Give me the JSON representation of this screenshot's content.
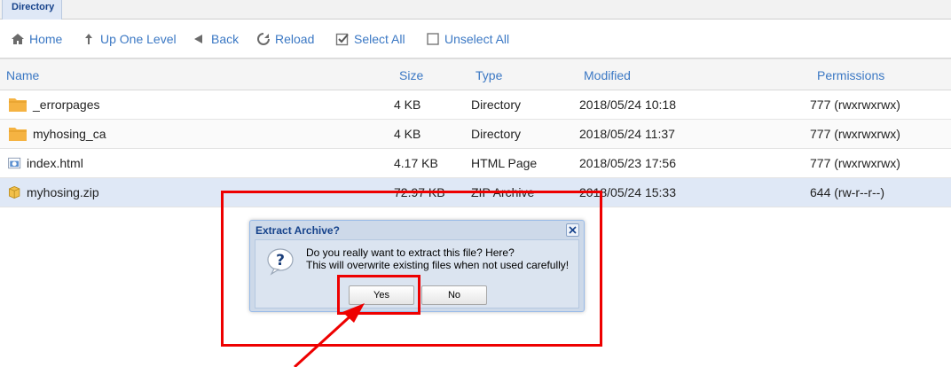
{
  "tab": {
    "label": "Directory"
  },
  "toolbar": {
    "home": "Home",
    "up_one_level": "Up One Level",
    "back": "Back",
    "reload": "Reload",
    "select_all": "Select All",
    "unselect_all": "Unselect All"
  },
  "columns": [
    "Name",
    "Size",
    "Type",
    "Modified",
    "Permissions"
  ],
  "rows": [
    {
      "name": "_errorpages",
      "size": "4 KB",
      "type": "Directory",
      "modified": "2018/05/24 10:18",
      "permissions": "777 (rwxrwxrwx)",
      "icon": "folder-icon"
    },
    {
      "name": "myhosing_ca",
      "size": "4 KB",
      "type": "Directory",
      "modified": "2018/05/24 11:37",
      "permissions": "777 (rwxrwxrwx)",
      "icon": "folder-icon"
    },
    {
      "name": "index.html",
      "size": "4.17 KB",
      "type": "HTML Page",
      "modified": "2018/05/23 17:56",
      "permissions": "777 (rwxrwxrwx)",
      "icon": "html-file-icon"
    },
    {
      "name": "myhosing.zip",
      "size": "72.97 KB",
      "type": "ZIP Archive",
      "modified": "2018/05/24 15:33",
      "permissions": "644 (rw-r--r--)",
      "icon": "zip-file-icon"
    }
  ],
  "dialog": {
    "title": "Extract Archive?",
    "line1": "Do you really want to extract this file? Here?",
    "line2": "This will overwrite existing files when not used carefully!",
    "yes": "Yes",
    "no": "No"
  },
  "colors": {
    "accent": "#3b78c4",
    "title_blue": "#15428b",
    "selected_row": "#dfe8f6",
    "annotation_red": "#ee0000",
    "folder": "#f5b342"
  }
}
